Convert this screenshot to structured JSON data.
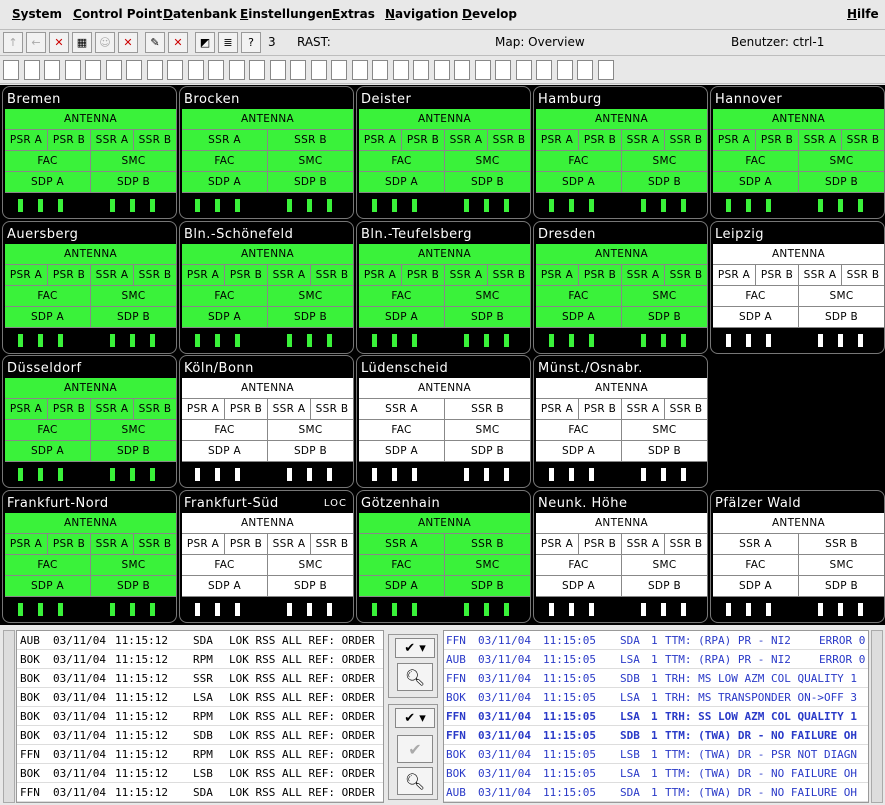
{
  "menu": [
    "System",
    "Control Point",
    "Datenbank",
    "Einstellungen",
    "Extras",
    "Navigation",
    "Develop"
  ],
  "help": "Hilfe",
  "toolbar": {
    "count": "3",
    "rast": "RAST:",
    "map": "Map: Overview",
    "user": "Benutzer: ctrl-1"
  },
  "tiles": [
    {
      "name": "Bremen",
      "state": "green",
      "rows": [
        [
          "ANTENNA"
        ],
        [
          "PSR A",
          "PSR B",
          "SSR A",
          "SSR B"
        ],
        [
          "FAC",
          "SMC"
        ],
        [
          "SDP A",
          "SDP B"
        ]
      ]
    },
    {
      "name": "Brocken",
      "state": "green",
      "rows": [
        [
          "ANTENNA"
        ],
        [
          "SSR A",
          "SSR B"
        ],
        [
          "FAC",
          "SMC"
        ],
        [
          "SDP A",
          "SDP B"
        ]
      ]
    },
    {
      "name": "Deister",
      "state": "green",
      "rows": [
        [
          "ANTENNA"
        ],
        [
          "PSR A",
          "PSR B",
          "SSR A",
          "SSR B"
        ],
        [
          "FAC",
          "SMC"
        ],
        [
          "SDP A",
          "SDP B"
        ]
      ]
    },
    {
      "name": "Hamburg",
      "state": "green",
      "rows": [
        [
          "ANTENNA"
        ],
        [
          "PSR A",
          "PSR B",
          "SSR A",
          "SSR B"
        ],
        [
          "FAC",
          "SMC"
        ],
        [
          "SDP A",
          "SDP B"
        ]
      ]
    },
    {
      "name": "Hannover",
      "state": "green",
      "rows": [
        [
          "ANTENNA"
        ],
        [
          "PSR A",
          "PSR B",
          "SSR A",
          "SSR B"
        ],
        [
          "FAC",
          "SMC"
        ],
        [
          "SDP A",
          "SDP B"
        ]
      ]
    },
    {
      "name": "Auersberg",
      "state": "green",
      "rows": [
        [
          "ANTENNA"
        ],
        [
          "PSR A",
          "PSR B",
          "SSR A",
          "SSR B"
        ],
        [
          "FAC",
          "SMC"
        ],
        [
          "SDP A",
          "SDP B"
        ]
      ]
    },
    {
      "name": "Bln.-Schönefeld",
      "state": "green",
      "rows": [
        [
          "ANTENNA"
        ],
        [
          "PSR A",
          "PSR B",
          "SSR A",
          "SSR B"
        ],
        [
          "FAC",
          "SMC"
        ],
        [
          "SDP A",
          "SDP B"
        ]
      ]
    },
    {
      "name": "Bln.-Teufelsberg",
      "state": "green",
      "rows": [
        [
          "ANTENNA"
        ],
        [
          "PSR A",
          "PSR B",
          "SSR A",
          "SSR B"
        ],
        [
          "FAC",
          "SMC"
        ],
        [
          "SDP A",
          "SDP B"
        ]
      ]
    },
    {
      "name": "Dresden",
      "state": "green",
      "rows": [
        [
          "ANTENNA"
        ],
        [
          "PSR A",
          "PSR B",
          "SSR A",
          "SSR B"
        ],
        [
          "FAC",
          "SMC"
        ],
        [
          "SDP A",
          "SDP B"
        ]
      ]
    },
    {
      "name": "Leipzig",
      "state": "white",
      "rows": [
        [
          "ANTENNA"
        ],
        [
          "PSR A",
          "PSR B",
          "SSR A",
          "SSR B"
        ],
        [
          "FAC",
          "SMC"
        ],
        [
          "SDP A",
          "SDP B"
        ]
      ]
    },
    {
      "name": "Düsseldorf",
      "state": "green",
      "rows": [
        [
          "ANTENNA"
        ],
        [
          "PSR A",
          "PSR B",
          "SSR A",
          "SSR B"
        ],
        [
          "FAC",
          "SMC"
        ],
        [
          "SDP A",
          "SDP B"
        ]
      ]
    },
    {
      "name": "Köln/Bonn",
      "state": "white",
      "rows": [
        [
          "ANTENNA"
        ],
        [
          "PSR A",
          "PSR B",
          "SSR A",
          "SSR B"
        ],
        [
          "FAC",
          "SMC"
        ],
        [
          "SDP A",
          "SDP B"
        ]
      ]
    },
    {
      "name": "Lüdenscheid",
      "state": "white",
      "rows": [
        [
          "ANTENNA"
        ],
        [
          "SSR A",
          "SSR B"
        ],
        [
          "FAC",
          "SMC"
        ],
        [
          "SDP A",
          "SDP B"
        ]
      ]
    },
    {
      "name": "Münst./Osnabr.",
      "state": "white",
      "rows": [
        [
          "ANTENNA"
        ],
        [
          "PSR A",
          "PSR B",
          "SSR A",
          "SSR B"
        ],
        [
          "FAC",
          "SMC"
        ],
        [
          "SDP A",
          "SDP B"
        ]
      ]
    },
    {
      "name": "Frankfurt-Nord",
      "state": "green",
      "rows": [
        [
          "ANTENNA"
        ],
        [
          "PSR A",
          "PSR B",
          "SSR A",
          "SSR B"
        ],
        [
          "FAC",
          "SMC"
        ],
        [
          "SDP A",
          "SDP B"
        ]
      ]
    },
    {
      "name": "Frankfurt-Süd",
      "state": "white",
      "loc": "LOC",
      "rows": [
        [
          "ANTENNA"
        ],
        [
          "PSR A",
          "PSR B",
          "SSR A",
          "SSR B"
        ],
        [
          "FAC",
          "SMC"
        ],
        [
          "SDP A",
          "SDP B"
        ]
      ]
    },
    {
      "name": "Götzenhain",
      "state": "green",
      "rows": [
        [
          "ANTENNA"
        ],
        [
          "SSR A",
          "SSR B"
        ],
        [
          "FAC",
          "SMC"
        ],
        [
          "SDP A",
          "SDP B"
        ]
      ]
    },
    {
      "name": "Neunk. Höhe",
      "state": "white",
      "rows": [
        [
          "ANTENNA"
        ],
        [
          "PSR A",
          "PSR B",
          "SSR A",
          "SSR B"
        ],
        [
          "FAC",
          "SMC"
        ],
        [
          "SDP A",
          "SDP B"
        ]
      ]
    },
    {
      "name": "Pfälzer Wald",
      "state": "white",
      "rows": [
        [
          "ANTENNA"
        ],
        [
          "SSR A",
          "SSR B"
        ],
        [
          "FAC",
          "SMC"
        ],
        [
          "SDP A",
          "SDP B"
        ]
      ]
    }
  ],
  "log_left": [
    [
      "AUB",
      "03/11/04",
      "11:15:12",
      "SDA",
      "LOK RSS ALL REF: ORDER"
    ],
    [
      "BOK",
      "03/11/04",
      "11:15:12",
      "RPM",
      "LOK RSS ALL REF: ORDER"
    ],
    [
      "BOK",
      "03/11/04",
      "11:15:12",
      "SSR",
      "LOK RSS ALL REF: ORDER"
    ],
    [
      "BOK",
      "03/11/04",
      "11:15:12",
      "LSA",
      "LOK RSS ALL REF: ORDER"
    ],
    [
      "BOK",
      "03/11/04",
      "11:15:12",
      "RPM",
      "LOK RSS ALL REF: ORDER"
    ],
    [
      "BOK",
      "03/11/04",
      "11:15:12",
      "SDB",
      "LOK RSS ALL REF: ORDER"
    ],
    [
      "FFN",
      "03/11/04",
      "11:15:12",
      "RPM",
      "LOK RSS ALL REF: ORDER"
    ],
    [
      "BOK",
      "03/11/04",
      "11:15:12",
      "LSB",
      "LOK RSS ALL REF: ORDER"
    ],
    [
      "FFN",
      "03/11/04",
      "11:15:12",
      "SDA",
      "LOK RSS ALL REF: ORDER"
    ]
  ],
  "log_right": [
    {
      "b": false,
      "f": [
        "FFN",
        "03/11/04",
        "11:15:05",
        "SDA",
        "1",
        "TTM: (RPA) PR - NI2",
        "ERROR 0"
      ]
    },
    {
      "b": false,
      "f": [
        "AUB",
        "03/11/04",
        "11:15:05",
        "LSA",
        "1",
        "TTM: (RPA) PR - NI2",
        "ERROR 0"
      ]
    },
    {
      "b": false,
      "f": [
        "FFN",
        "03/11/04",
        "11:15:05",
        "SDB",
        "1",
        "TRH: MS LOW AZM COL QUALITY 1",
        ""
      ]
    },
    {
      "b": false,
      "f": [
        "BOK",
        "03/11/04",
        "11:15:05",
        "LSA",
        "1",
        "TRH: MS TRANSPONDER ON->OFF 3",
        ""
      ]
    },
    {
      "b": true,
      "f": [
        "FFN",
        "03/11/04",
        "11:15:05",
        "LSA",
        "1",
        "TRH: SS LOW AZM COL QUALITY 1",
        ""
      ]
    },
    {
      "b": true,
      "f": [
        "FFN",
        "03/11/04",
        "11:15:05",
        "SDB",
        "1",
        "TTM: (TWA) DR - NO FAILURE OH",
        ""
      ]
    },
    {
      "b": false,
      "f": [
        "BOK",
        "03/11/04",
        "11:15:05",
        "LSB",
        "1",
        "TTM: (TWA) DR - PSR NOT DIAGN",
        ""
      ]
    },
    {
      "b": false,
      "f": [
        "BOK",
        "03/11/04",
        "11:15:05",
        "LSA",
        "1",
        "TTM: (TWA) DR - NO FAILURE OH",
        ""
      ]
    },
    {
      "b": false,
      "f": [
        "AUB",
        "03/11/04",
        "11:15:05",
        "SDA",
        "1",
        "TTM: (TWA) DR - NO FAILURE OH",
        ""
      ]
    }
  ]
}
